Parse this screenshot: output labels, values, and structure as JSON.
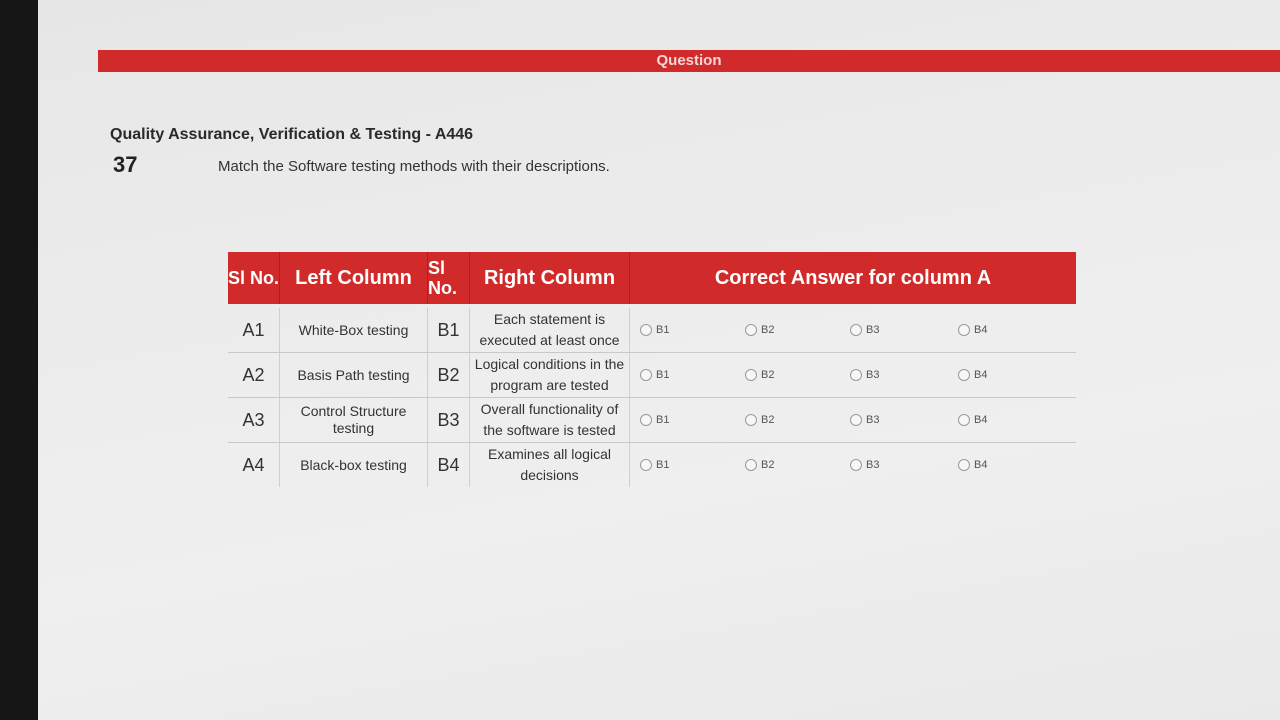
{
  "header_bar": {
    "label": "Question"
  },
  "course": {
    "title": "Quality Assurance, Verification & Testing - A446"
  },
  "question": {
    "number": "37",
    "text": "Match the Software testing methods with their descriptions."
  },
  "table": {
    "headers": {
      "sl_no": "Sl No.",
      "left_column": "Left Column",
      "sl_no_right": "Sl No.",
      "right_column": "Right Column",
      "correct_answer": "Correct Answer for column A"
    },
    "rows": [
      {
        "left_id": "A1",
        "left_text": "White-Box testing",
        "right_id": "B1",
        "right_text": "Each statement is executed at least once",
        "options": [
          "B1",
          "B2",
          "B3",
          "B4"
        ]
      },
      {
        "left_id": "A2",
        "left_text": "Basis Path testing",
        "right_id": "B2",
        "right_text": "Logical conditions in the program are tested",
        "options": [
          "B1",
          "B2",
          "B3",
          "B4"
        ]
      },
      {
        "left_id": "A3",
        "left_text": "Control Structure testing",
        "right_id": "B3",
        "right_text": "Overall functionality of the software is tested",
        "options": [
          "B1",
          "B2",
          "B3",
          "B4"
        ]
      },
      {
        "left_id": "A4",
        "left_text": "Black-box testing",
        "right_id": "B4",
        "right_text": "Examines all logical decisions",
        "options": [
          "B1",
          "B2",
          "B3",
          "B4"
        ]
      }
    ]
  },
  "colors": {
    "accent": "#d12a2a",
    "text": "#333333",
    "background": "#ececec"
  }
}
